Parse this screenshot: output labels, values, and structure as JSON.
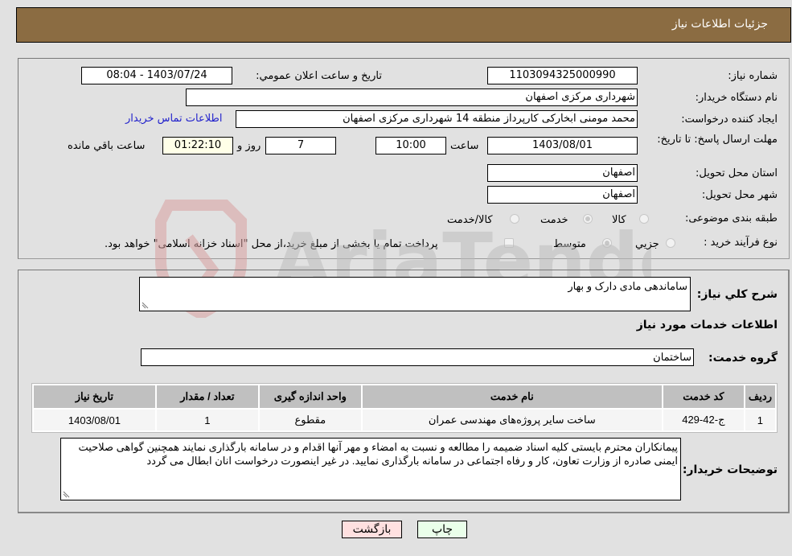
{
  "header": {
    "title": "جزئیات اطلاعات نیاز"
  },
  "form": {
    "need_number": {
      "label": "شماره نیاز:",
      "value": "1103094325000990"
    },
    "announce_datetime": {
      "label": "تاریخ و ساعت اعلان عمومي:",
      "value": "1403/07/24 - 08:04"
    },
    "buyer_org": {
      "label": "نام دستگاه خريدار:",
      "value": "شهرداری مرکزی اصفهان"
    },
    "requester": {
      "label": "ايجاد کننده درخواست:",
      "value": "محمد مومنی ابخارکی کارپرداز منطقه 14 شهرداری مرکزی اصفهان",
      "contact_link": "اطلاعات تماس خريدار"
    },
    "deadline": {
      "label": "مهلت ارسال پاسخ: تا تاریخ:",
      "date": "1403/08/01",
      "time_label": "ساعت",
      "time": "10:00",
      "days": "7",
      "days_label": "روز و",
      "remaining": "01:22:10",
      "remaining_label": "ساعت باقي مانده"
    },
    "province": {
      "label": "استان محل تحويل:",
      "value": "اصفهان"
    },
    "city": {
      "label": "شهر محل تحويل:",
      "value": "اصفهان"
    },
    "category": {
      "label": "طبقه بندی موضوعی:",
      "options": [
        {
          "label": "کالا",
          "checked": false
        },
        {
          "label": "خدمت",
          "checked": true
        },
        {
          "label": "کالا/خدمت",
          "checked": false
        }
      ]
    },
    "purchase_type": {
      "label": "نوع فرآيند خريد :",
      "options": [
        {
          "label": "جزيي",
          "checked": false
        },
        {
          "label": "متوسط",
          "checked": true
        }
      ],
      "treasury_checkbox": {
        "label": "پرداخت تمام يا بخشی از مبلغ خريد،از محل \"اسناد خزانه اسلامی\" خواهد بود.",
        "checked": false
      }
    }
  },
  "details": {
    "description_label": "شرح کلي نياز:",
    "description": "ساماندهی مادی دارک و بهار",
    "services_heading": "اطلاعات خدمات مورد نياز",
    "service_group_label": "گروه خدمت:",
    "service_group": "ساختمان",
    "table": {
      "headers": [
        "رديف",
        "کد خدمت",
        "نام خدمت",
        "واحد اندازه گيری",
        "تعداد / مقدار",
        "تاريخ نياز"
      ],
      "rows": [
        [
          "1",
          "ج-42-429",
          "ساخت سایر پروژه‌های مهندسی عمران",
          "مقطوع",
          "1",
          "1403/08/01"
        ]
      ]
    },
    "buyer_notes_label": "توضيحات خريدار:",
    "buyer_notes": "پیمانکاران محترم بایستی کلیه اسناد ضمیمه را مطالعه و نسبت به امضاء و مهر آنها اقدام و در سامانه بارگذاری نمایند همچنین گواهی صلاحیت ایمنی صادره از وزارت تعاون، کار و رفاه اجتماعی در سامانه بارگذاری نمایید. در غیر اینصورت درخواست انان ابطال می گردد"
  },
  "buttons": {
    "print": "چاپ",
    "back": "بازگشت"
  },
  "watermark": {
    "text": "AriaTender.neT"
  },
  "colors": {
    "header_bg": "#8b6c42",
    "print_bg": "#eaffea",
    "back_bg": "#ffe0e0",
    "remaining_bg": "#ffffe8"
  }
}
